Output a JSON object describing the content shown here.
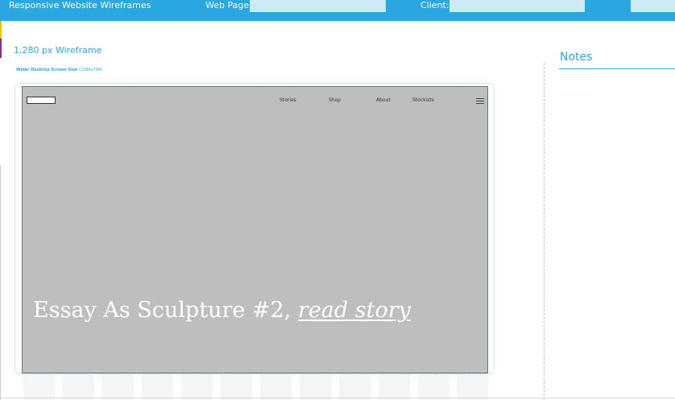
{
  "header": {
    "title": "Responsive Website Wireframes",
    "web_page_label": "Web Page:",
    "web_page_value": "",
    "client_label": "Client:",
    "client_value": "",
    "extra_value": ""
  },
  "wireframe": {
    "title": "1,280 px Wireframe",
    "subtitle": "Wider Desktop Screen Size",
    "subtitle_dim": "(1280x768)"
  },
  "site": {
    "nav": [
      "Stories",
      "Shop",
      "About",
      "Stockists"
    ],
    "hero_text": "Essay As Sculpture #2, ",
    "hero_link": "read story"
  },
  "notes": {
    "title": "Notes"
  },
  "colors": {
    "accent": "#2aa7e0",
    "screen_grey": "#bdbec0"
  }
}
